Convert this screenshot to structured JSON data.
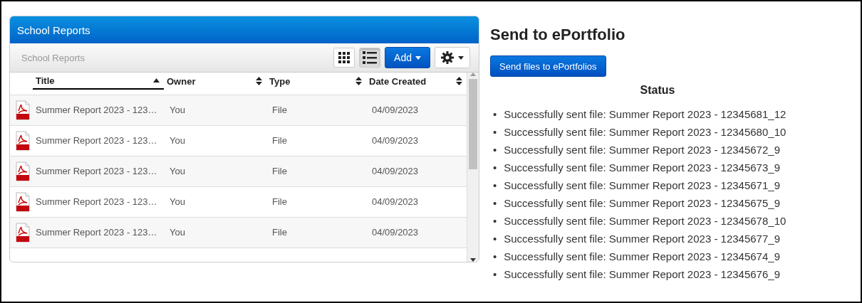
{
  "panel": {
    "title": "School Reports",
    "breadcrumb": "School Reports",
    "view_buttons": [
      {
        "kind": "grid",
        "selected": false
      },
      {
        "kind": "list",
        "selected": true
      }
    ],
    "add_button": "Add",
    "columns": [
      {
        "label": "Title",
        "sorted": true
      },
      {
        "label": "Owner",
        "sorted": false
      },
      {
        "label": "Type",
        "sorted": false
      },
      {
        "label": "Date Created",
        "sorted": false
      }
    ],
    "rows": [
      {
        "title": "Summer Report 2023 - 123…",
        "owner": "You",
        "type": "File",
        "date": "04/09/2023"
      },
      {
        "title": "Summer Report 2023 - 123…",
        "owner": "You",
        "type": "File",
        "date": "04/09/2023"
      },
      {
        "title": "Summer Report 2023 - 123…",
        "owner": "You",
        "type": "File",
        "date": "04/09/2023"
      },
      {
        "title": "Summer Report 2023 - 123…",
        "owner": "You",
        "type": "File",
        "date": "04/09/2023"
      },
      {
        "title": "Summer Report 2023 - 123…",
        "owner": "You",
        "type": "File",
        "date": "04/09/2023"
      }
    ]
  },
  "send": {
    "heading": "Send to ePortfolio",
    "button": "Send files to ePortfolios",
    "status_heading": "Status",
    "messages": [
      {
        "marker": "•",
        "text": "Successfully sent file: Summer Report 2023 - 12345681_12"
      },
      {
        "marker": "•",
        "text": "Successfully sent file: Summer Report 2023 - 12345680_10"
      },
      {
        "marker": "•",
        "text": "Successfully sent file: Summer Report 2023 - 12345672_9"
      },
      {
        "marker": "•",
        "text": "Successfully sent file: Summer Report 2023 - 12345673_9"
      },
      {
        "marker": "•",
        "text": "Successfully sent file: Summer Report 2023 - 12345671_9"
      },
      {
        "marker": "•",
        "text": "Successfully sent file: Summer Report 2023 - 12345675_9"
      },
      {
        "marker": "•",
        "text": "Successfully sent file: Summer Report 2023 - 12345678_10"
      },
      {
        "marker": "•",
        "text": "Successfully sent file: Summer Report 2023 - 12345677_9"
      },
      {
        "marker": "•",
        "text": "Successfully sent file: Summer Report 2023 - 12345674_9"
      },
      {
        "marker": "•",
        "text": "Successfully sent file: Summer Report 2023 - 12345676_9"
      }
    ]
  }
}
